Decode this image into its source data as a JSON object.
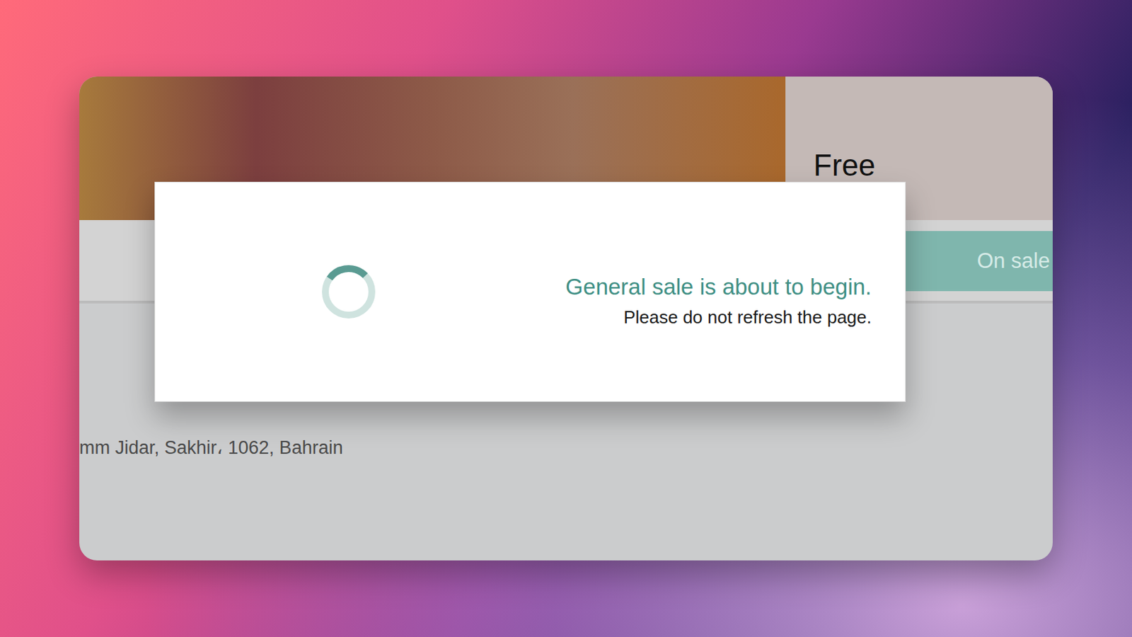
{
  "event_card": {
    "price_label": "Free",
    "status_button": "On sale",
    "address": "mm Jidar, Sakhir، 1062, Bahrain"
  },
  "dialog": {
    "title": "General sale is about to begin.",
    "message": "Please do not refresh the page.",
    "spinner": {
      "level": 0.28
    }
  }
}
